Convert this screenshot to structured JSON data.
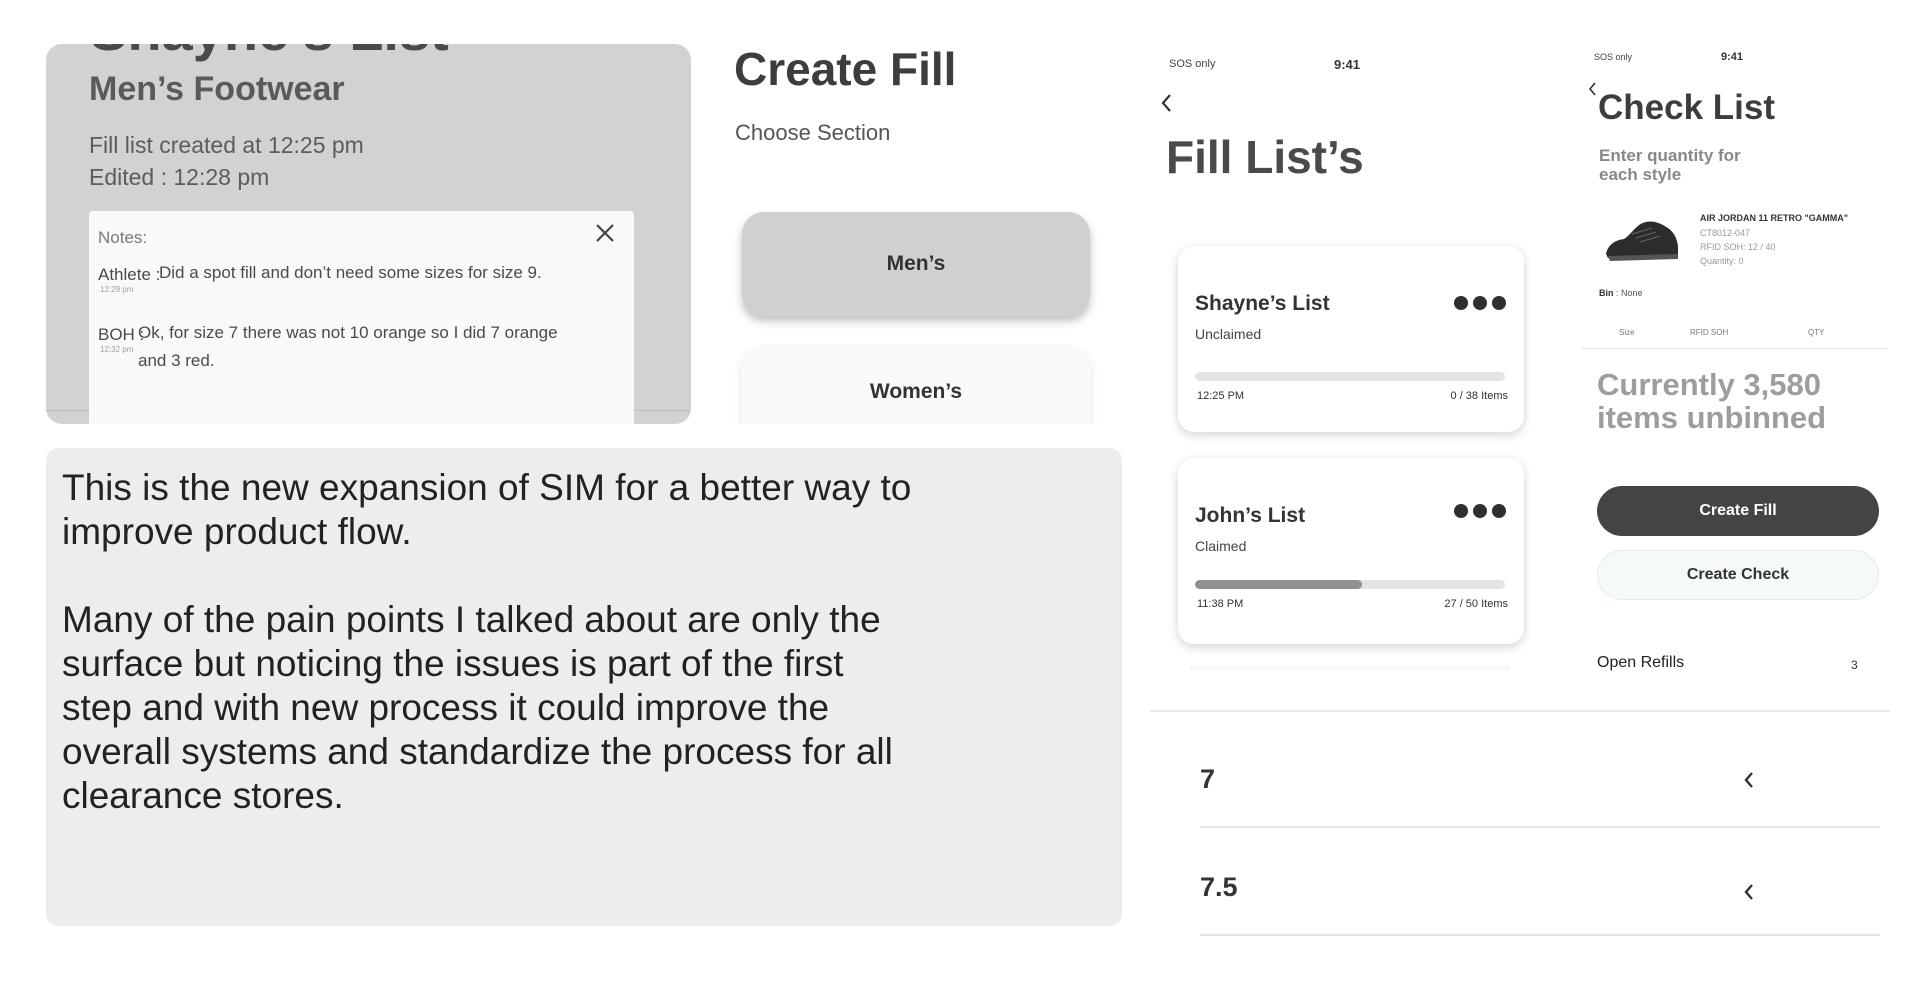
{
  "panel_mens_footwear": {
    "cut_title": "Shayne's List",
    "subtitle": "Men’s Footwear",
    "created": "Fill list created at 12:25 pm",
    "edited": "Edited : 12:28 pm",
    "notes": {
      "label": "Notes:",
      "entries": [
        {
          "author": "Athlete :",
          "text": "Did a spot fill and don’t need some sizes for size 9.",
          "time": "12:29 pm"
        },
        {
          "author": "BOH :",
          "text_line1": "Ok, for size 7 there was not 10 orange so I did 7 orange",
          "text_line2": "and 3 red.",
          "time": "12:32 pm"
        }
      ]
    }
  },
  "panel_create_fill": {
    "title": "Create Fill",
    "subtitle": "Choose Section",
    "sections": [
      "Men’s",
      "Women’s"
    ]
  },
  "description": {
    "paragraph1": "This is the new expansion of SIM for a better way to improve product flow.",
    "paragraph2": "Many of the pain points I talked about are only the surface but noticing the issues is part of the first step and with new process it could improve the overall systems and standardize the process for all clearance stores."
  },
  "panel_fill_lists": {
    "status": {
      "carrier": "SOS only",
      "time": "9:41"
    },
    "title": "Fill List’s",
    "lists": [
      {
        "name": "Shayne’s List",
        "state": "Unclaimed",
        "time": "12:25 PM",
        "count": "0 / 38 Items",
        "progress": 0
      },
      {
        "name": "John’s List",
        "state": "Claimed",
        "time": "11:38 PM",
        "count": "27 / 50 Items",
        "progress": 0.54
      }
    ]
  },
  "panel_check_list": {
    "status": {
      "carrier": "SOS only",
      "time": "9:41"
    },
    "title": "Check List",
    "instruction": "Enter quantity for each style",
    "product": {
      "name": "AIR JORDAN 11 RETRO \"GAMMA\"",
      "sku": "CT8012-047",
      "rfid": "RFID SOH: 12 / 40",
      "quantity": "Quantity: 0"
    },
    "bin_label": "Bin",
    "bin_value": " : None",
    "columns": [
      "Size",
      "RFID SOH",
      "QTY"
    ],
    "currently": "Currently  3,580 items unbinned",
    "buttons": {
      "create_fill": "Create Fill",
      "create_check": "Create Check"
    },
    "open_refills": {
      "label": "Open Refills",
      "count": "3"
    }
  },
  "sizes": [
    "7",
    "7.5"
  ]
}
